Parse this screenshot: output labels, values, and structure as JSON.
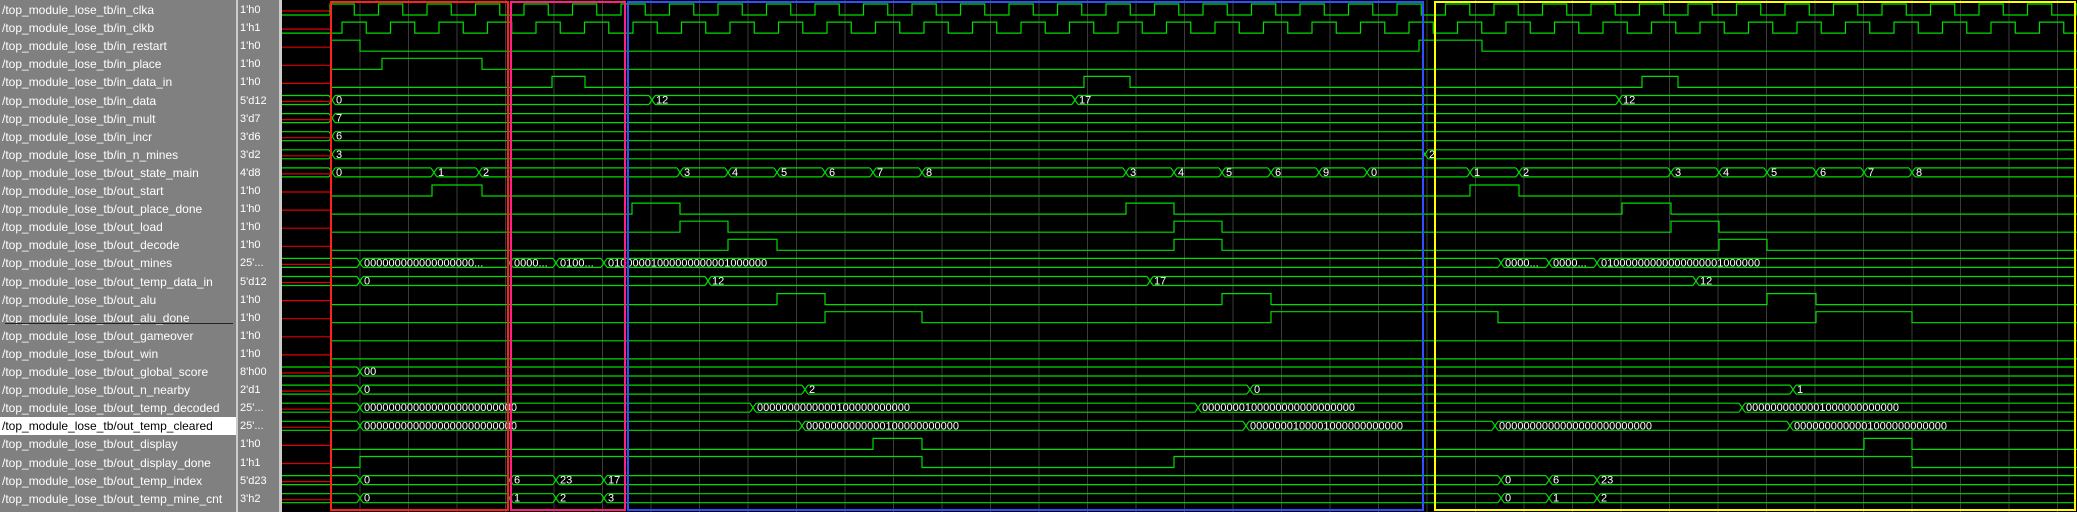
{
  "signals": [
    {
      "name": "/top_module_lose_tb/in_clka",
      "value": "1'h0"
    },
    {
      "name": "/top_module_lose_tb/in_clkb",
      "value": "1'h1"
    },
    {
      "name": "/top_module_lose_tb/in_restart",
      "value": "1'h0"
    },
    {
      "name": "/top_module_lose_tb/in_place",
      "value": "1'h0"
    },
    {
      "name": "/top_module_lose_tb/in_data_in",
      "value": "1'h0"
    },
    {
      "name": "/top_module_lose_tb/in_data",
      "value": "5'd12"
    },
    {
      "name": "/top_module_lose_tb/in_mult",
      "value": "3'd7"
    },
    {
      "name": "/top_module_lose_tb/in_incr",
      "value": "3'd6"
    },
    {
      "name": "/top_module_lose_tb/in_n_mines",
      "value": "3'd2"
    },
    {
      "name": "/top_module_lose_tb/out_state_main",
      "value": "4'd8"
    },
    {
      "name": "/top_module_lose_tb/out_start",
      "value": "1'h0"
    },
    {
      "name": "/top_module_lose_tb/out_place_done",
      "value": "1'h0"
    },
    {
      "name": "/top_module_lose_tb/out_load",
      "value": "1'h0"
    },
    {
      "name": "/top_module_lose_tb/out_decode",
      "value": "1'h0"
    },
    {
      "name": "/top_module_lose_tb/out_mines",
      "value": "25'..."
    },
    {
      "name": "/top_module_lose_tb/out_temp_data_in",
      "value": "5'd12"
    },
    {
      "name": "/top_module_lose_tb/out_alu",
      "value": "1'h0"
    },
    {
      "name": "/top_module_lose_tb/out_alu_done",
      "value": "1'h0"
    },
    {
      "name": "/top_module_lose_tb/out_gameover",
      "value": "1'h0"
    },
    {
      "name": "/top_module_lose_tb/out_win",
      "value": "1'h0"
    },
    {
      "name": "/top_module_lose_tb/out_global_score",
      "value": "8'h00"
    },
    {
      "name": "/top_module_lose_tb/out_n_nearby",
      "value": "2'd1"
    },
    {
      "name": "/top_module_lose_tb/out_temp_decoded",
      "value": "25'..."
    },
    {
      "name": "/top_module_lose_tb/out_temp_cleared",
      "value": "25'..."
    },
    {
      "name": "/top_module_lose_tb/out_display",
      "value": "1'h0"
    },
    {
      "name": "/top_module_lose_tb/out_display_done",
      "value": "1'h1"
    },
    {
      "name": "/top_module_lose_tb/out_temp_index",
      "value": "5'd23"
    },
    {
      "name": "/top_module_lose_tb/out_temp_mine_cnt",
      "value": "3'h2"
    }
  ],
  "selected_index": 23,
  "bus_labels": [
    {
      "row": 5,
      "items": [
        [
          "0",
          50
        ],
        [
          "12",
          370
        ],
        [
          "17",
          793
        ],
        [
          "12",
          1337
        ]
      ]
    },
    {
      "row": 6,
      "items": [
        [
          "7",
          50
        ]
      ]
    },
    {
      "row": 7,
      "items": [
        [
          "6",
          50
        ]
      ]
    },
    {
      "row": 8,
      "items": [
        [
          "3",
          50
        ],
        [
          "2",
          1143
        ]
      ]
    },
    {
      "row": 9,
      "items": [
        [
          "0",
          50
        ],
        [
          "1",
          152
        ],
        [
          "2",
          197
        ],
        [
          "3",
          398
        ],
        [
          "4",
          446
        ],
        [
          "5",
          495
        ],
        [
          "6",
          543
        ],
        [
          "7",
          591
        ],
        [
          "8",
          640
        ],
        [
          "3",
          844
        ],
        [
          "4",
          892
        ],
        [
          "5",
          940
        ],
        [
          "6",
          989
        ],
        [
          "9",
          1037
        ],
        [
          "0",
          1085
        ],
        [
          "1",
          1188
        ],
        [
          "2",
          1237
        ],
        [
          "3",
          1389
        ],
        [
          "4",
          1437
        ],
        [
          "5",
          1485
        ],
        [
          "6",
          1534
        ],
        [
          "7",
          1582
        ],
        [
          "8",
          1630
        ]
      ]
    },
    {
      "row": 14,
      "items": [
        [
          "000000000000000000...",
          78
        ],
        [
          "0000...",
          228
        ],
        [
          "0100...",
          274
        ],
        [
          "01000001000000000001000000",
          322
        ],
        [
          "0000...",
          1219
        ],
        [
          "0000...",
          1267
        ],
        [
          "01000000000000000001000000",
          1315
        ]
      ]
    },
    {
      "row": 15,
      "items": [
        [
          "0",
          78
        ],
        [
          "12",
          426
        ],
        [
          "17",
          868
        ],
        [
          "12",
          1414
        ]
      ]
    },
    {
      "row": 20,
      "items": [
        [
          "00",
          78
        ]
      ]
    },
    {
      "row": 21,
      "items": [
        [
          "0",
          78
        ],
        [
          "2",
          523
        ],
        [
          "0",
          968
        ],
        [
          "1",
          1511
        ]
      ]
    },
    {
      "row": 22,
      "items": [
        [
          "0000000000000000000000000",
          78
        ],
        [
          "0000000000000100000000000",
          471
        ],
        [
          "0000000100000000000000000",
          916
        ],
        [
          "0000000000001000000000000",
          1460
        ]
      ]
    },
    {
      "row": 23,
      "items": [
        [
          "0000000000000000000000000",
          78
        ],
        [
          "0000000000000100000000000",
          520
        ],
        [
          "0000000100001000000000000",
          964
        ],
        [
          "0000000000000000000000000",
          1213
        ],
        [
          "0000000000001000000000000",
          1508
        ]
      ]
    },
    {
      "row": 26,
      "items": [
        [
          "0",
          78
        ],
        [
          "6",
          228
        ],
        [
          "23",
          274
        ],
        [
          "17",
          322
        ],
        [
          "0",
          1219
        ],
        [
          "6",
          1267
        ],
        [
          "23",
          1315
        ]
      ]
    },
    {
      "row": 27,
      "items": [
        [
          "0",
          78
        ],
        [
          "1",
          228
        ],
        [
          "2",
          274
        ],
        [
          "3",
          322
        ],
        [
          "0",
          1219
        ],
        [
          "1",
          1267
        ],
        [
          "2",
          1315
        ]
      ]
    }
  ],
  "markers": [
    {
      "color": "#ff2020"
    },
    {
      "color": "#ff2080"
    },
    {
      "color": "#3050ff"
    },
    {
      "color": "#ffff00"
    }
  ],
  "colors": {
    "wave": "#00dd00",
    "bg": "#000000",
    "grid": "#555555"
  }
}
